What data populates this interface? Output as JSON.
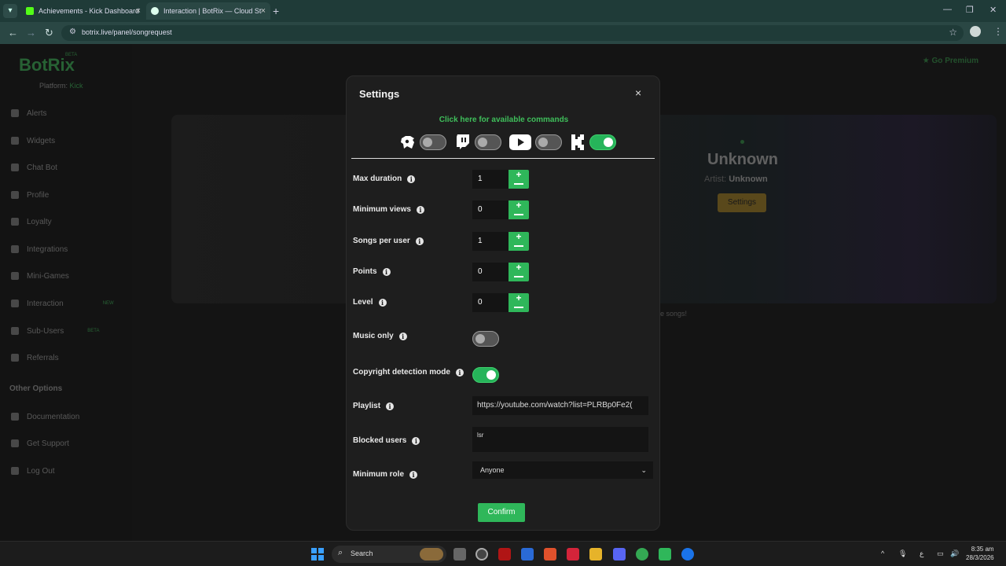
{
  "browser": {
    "tabs": [
      {
        "title": "Achievements - Kick Dashboard",
        "active": false
      },
      {
        "title": "Interaction | BotRix — Cloud St",
        "active": true
      }
    ],
    "url": "botrix.live/panel/songrequest"
  },
  "background": {
    "logo": "BotRix",
    "logo_badge": "BETA",
    "platform_label": "Platform:",
    "platform_value": "Kick",
    "sidebar_items": [
      "Alerts",
      "Widgets",
      "Chat Bot",
      "Profile",
      "Loyalty",
      "Integrations",
      "Mini-Games",
      "Interaction",
      "Sub-Users",
      "Referrals"
    ],
    "sidebar_badges": {
      "interaction": "NEW",
      "subusers": "BETA"
    },
    "other_heading": "Other Options",
    "other_items": [
      "Documentation",
      "Get Support",
      "Log Out"
    ],
    "go_premium": "Go Premium",
    "now_playing_title": "Unknown",
    "artist_label": "Artist:",
    "artist_value": "Unknown",
    "settings_button": "Settings",
    "note_text": "e songs!"
  },
  "modal": {
    "title": "Settings",
    "close": "×",
    "commands_link": "Click here for available commands",
    "platforms": [
      {
        "name": "botrix",
        "enabled": false
      },
      {
        "name": "twitch",
        "enabled": false
      },
      {
        "name": "youtube",
        "enabled": false
      },
      {
        "name": "kick",
        "enabled": true
      }
    ],
    "fields": {
      "max_duration": {
        "label": "Max duration",
        "value": "1"
      },
      "min_views": {
        "label": "Minimum views",
        "value": "0"
      },
      "songs_per_user": {
        "label": "Songs per user",
        "value": "1"
      },
      "points": {
        "label": "Points",
        "value": "0"
      },
      "level": {
        "label": "Level",
        "value": "0"
      }
    },
    "music_only": {
      "label": "Music only",
      "enabled": false
    },
    "copyright": {
      "label": "Copyright detection mode",
      "enabled": true
    },
    "playlist": {
      "label": "Playlist",
      "value": "https://youtube.com/watch?list=PLRBp0Fe2("
    },
    "blocked_users": {
      "label": "Blocked users",
      "value": "lsr"
    },
    "minimum_role": {
      "label": "Minimum role",
      "value": "Anyone"
    },
    "confirm": "Confirm"
  },
  "taskbar": {
    "search": "Search",
    "time": "8:35 am",
    "date": "28/3/2026"
  }
}
